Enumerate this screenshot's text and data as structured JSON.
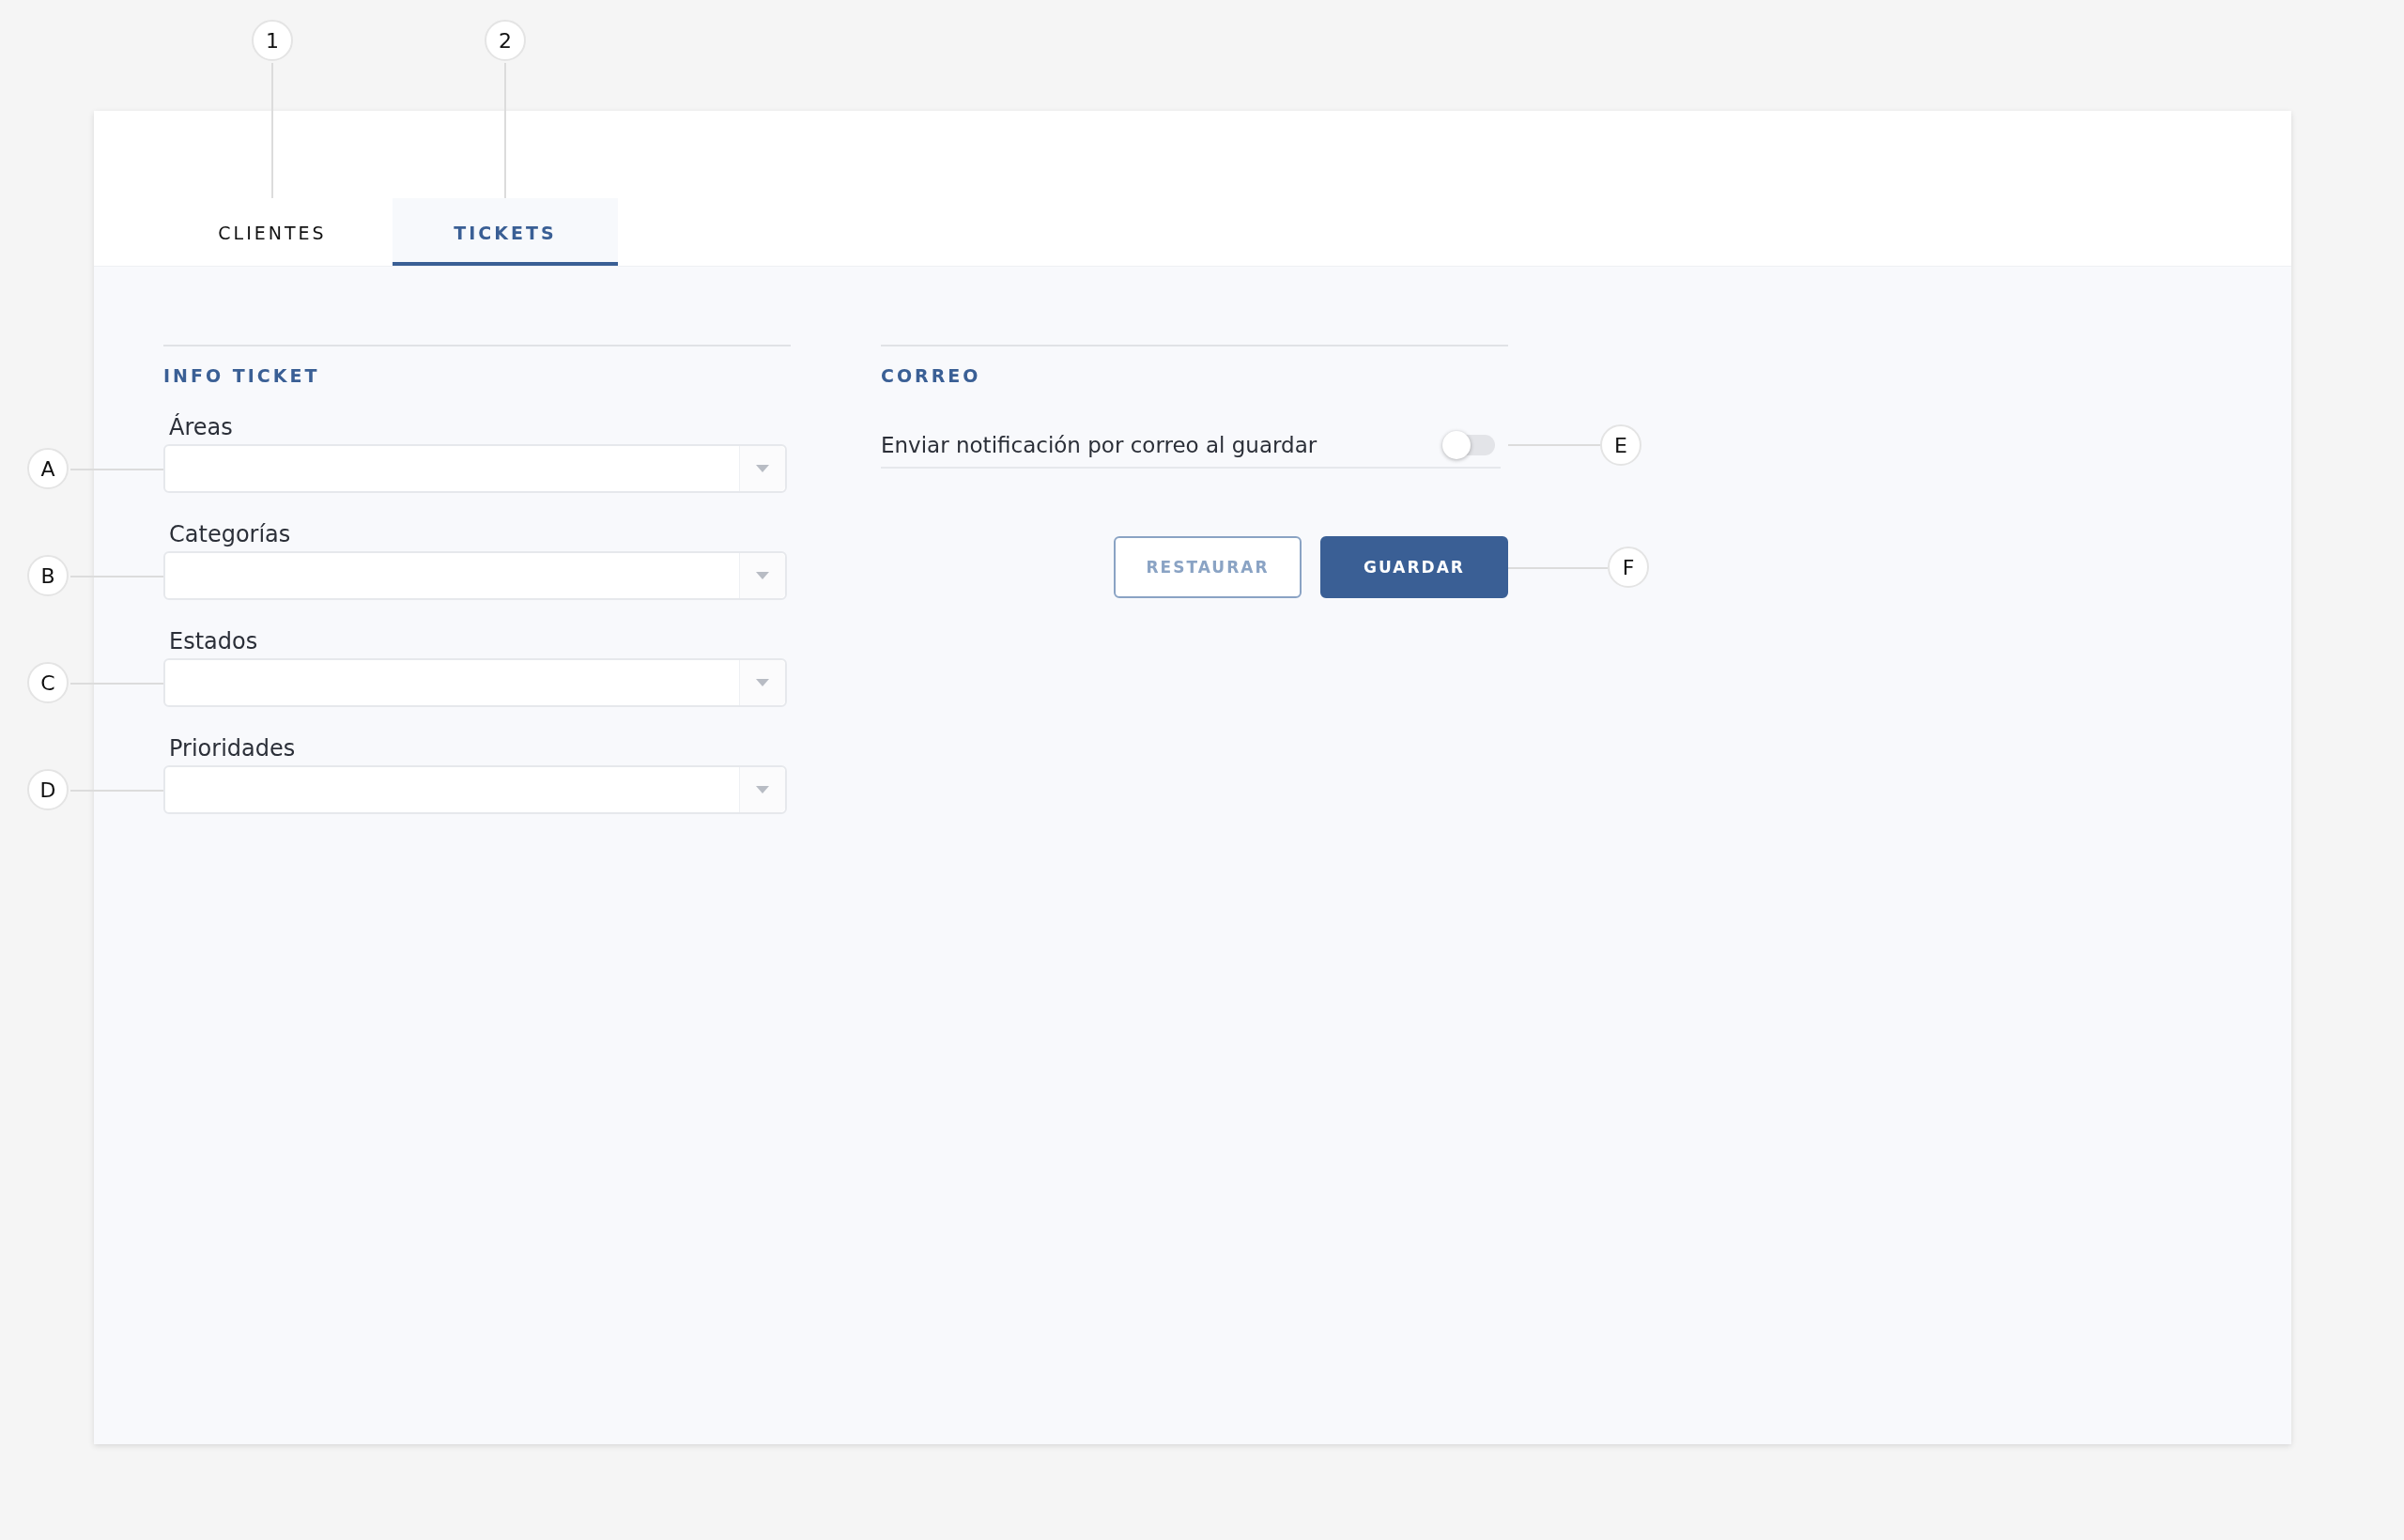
{
  "tabs": [
    {
      "label": "CLIENTES",
      "selected": false,
      "callout": "1"
    },
    {
      "label": "TICKETS",
      "selected": true,
      "callout": "2"
    }
  ],
  "info_ticket": {
    "title": "INFO TICKET",
    "fields": [
      {
        "label": "Áreas",
        "callout": "A"
      },
      {
        "label": "Categorías",
        "callout": "B"
      },
      {
        "label": "Estados",
        "callout": "C"
      },
      {
        "label": "Prioridades",
        "callout": "D"
      }
    ]
  },
  "correo": {
    "title": "CORREO",
    "toggle": {
      "label": "Enviar notificación por correo al guardar",
      "on": false,
      "callout": "E"
    },
    "buttons": [
      {
        "label": "RESTAURAR",
        "kind": "secondary"
      },
      {
        "label": "GUARDAR",
        "kind": "primary"
      }
    ],
    "buttons_callout": "F"
  }
}
